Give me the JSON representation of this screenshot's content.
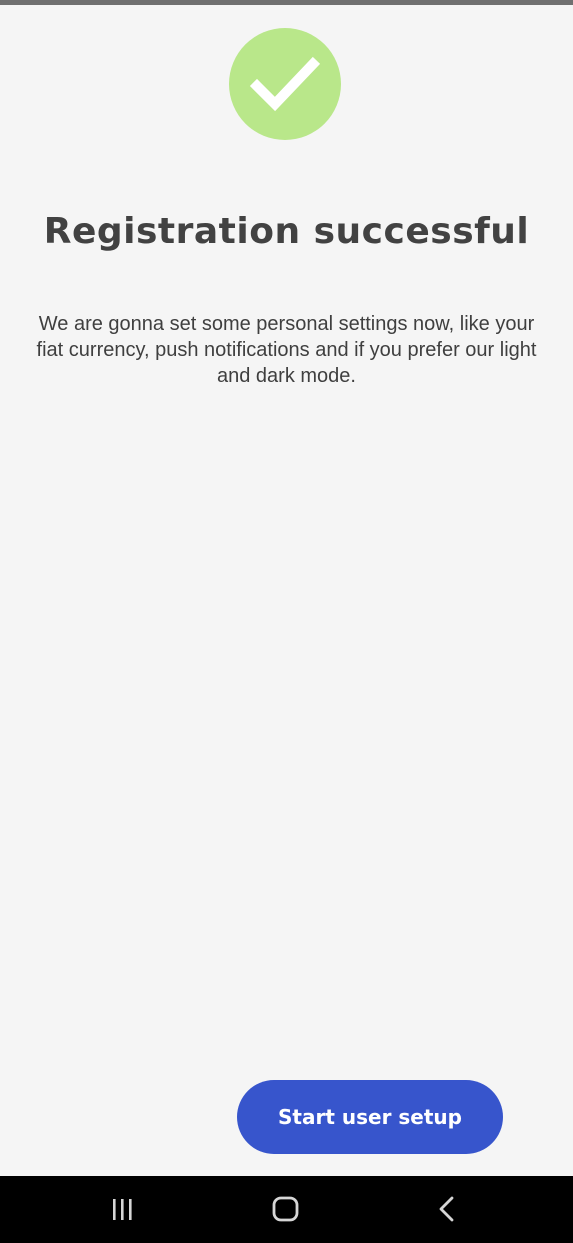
{
  "registration": {
    "status_icon": "checkmark-icon",
    "title": "Registration successful",
    "description": "We are gonna set some personal settings now, like your fiat currency, push notifications and if you prefer our light and dark mode.",
    "start_button_label": "Start user setup"
  },
  "navigation_bar": {
    "items": [
      {
        "icon": "recent-apps-icon"
      },
      {
        "icon": "home-icon"
      },
      {
        "icon": "back-icon"
      }
    ]
  },
  "colors": {
    "background": "#f5f5f5",
    "success_badge": "#b9e78a",
    "primary_button": "#3755cc",
    "title_text": "#424242",
    "body_text": "#3f3f3f",
    "nav_bar": "#000000"
  }
}
